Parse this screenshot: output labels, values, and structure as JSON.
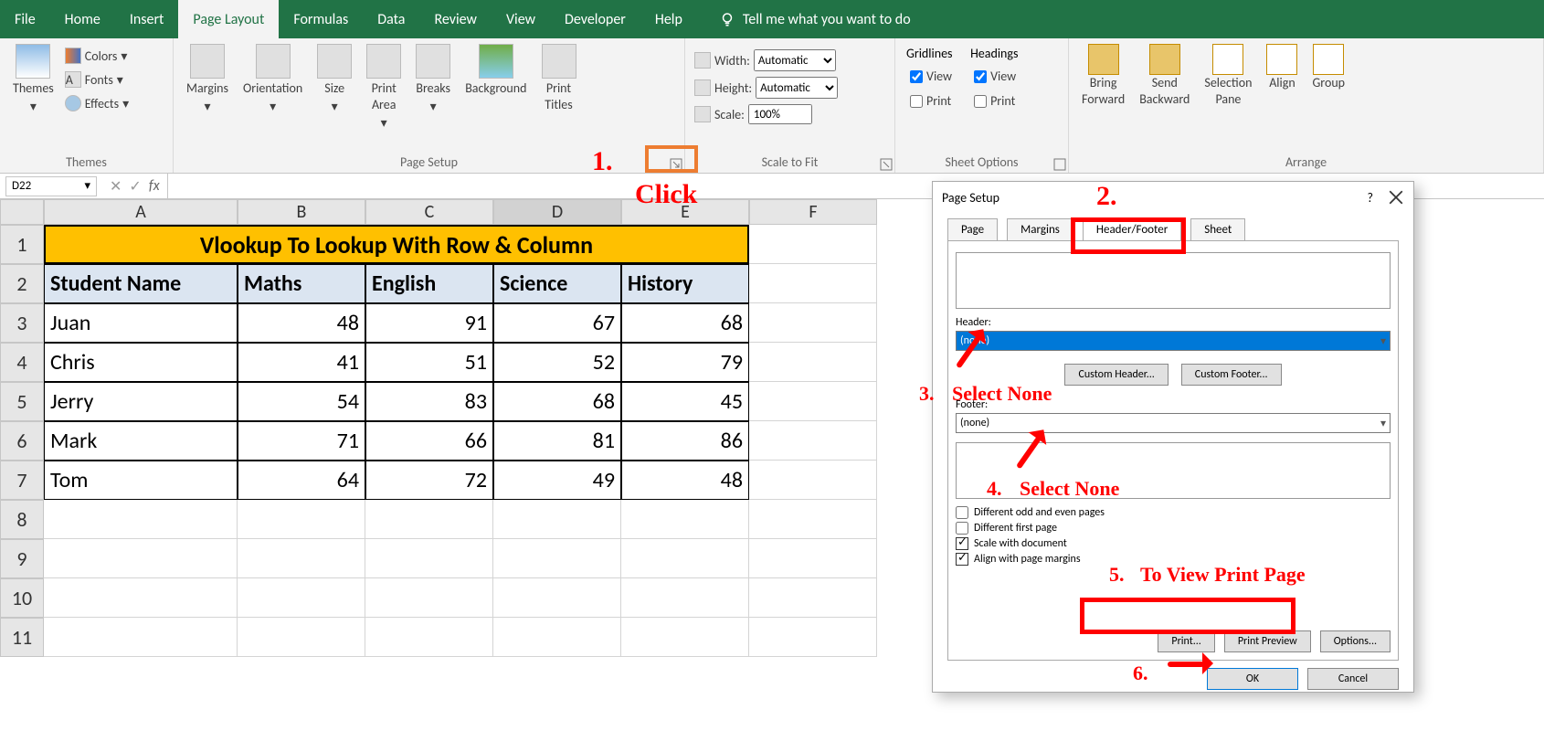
{
  "ribbon": {
    "tabs": [
      "File",
      "Home",
      "Insert",
      "Page Layout",
      "Formulas",
      "Data",
      "Review",
      "View",
      "Developer",
      "Help"
    ],
    "active": "Page Layout",
    "tell_me": "Tell me what you want to do"
  },
  "ribbon_groups": {
    "themes": {
      "label": "Themes",
      "big": "Themes",
      "items": [
        "Colors",
        "Fonts",
        "Effects"
      ]
    },
    "page_setup": {
      "label": "Page Setup",
      "buttons": [
        "Margins",
        "Orientation",
        "Size",
        "Print\nArea",
        "Breaks",
        "Background",
        "Print\nTitles"
      ]
    },
    "scale": {
      "label": "Scale to Fit",
      "width_lbl": "Width:",
      "width_val": "Automatic",
      "height_lbl": "Height:",
      "height_val": "Automatic",
      "scale_lbl": "Scale:",
      "scale_val": "100%"
    },
    "sheet_options": {
      "label": "Sheet Options",
      "gridlines": "Gridlines",
      "headings": "Headings",
      "view": "View",
      "print": "Print"
    },
    "arrange": {
      "label": "Arrange",
      "buttons": [
        "Bring\nForward",
        "Send\nBackward",
        "Selection\nPane",
        "Align",
        "Group"
      ]
    }
  },
  "name_box": "D22",
  "columns": [
    "A",
    "B",
    "C",
    "D",
    "E",
    "F"
  ],
  "rows": [
    "1",
    "2",
    "3",
    "4",
    "5",
    "6",
    "7",
    "8",
    "9",
    "10",
    "11"
  ],
  "title_cell": "Vlookup To Lookup With Row & Column",
  "headers": [
    "Student Name",
    "Maths",
    "English",
    "Science",
    "History"
  ],
  "data": [
    {
      "name": "Juan",
      "m": "48",
      "e": "91",
      "s": "67",
      "h": "68"
    },
    {
      "name": "Chris",
      "m": "41",
      "e": "51",
      "s": "52",
      "h": "79"
    },
    {
      "name": "Jerry",
      "m": "54",
      "e": "83",
      "s": "68",
      "h": "45"
    },
    {
      "name": "Mark",
      "m": "71",
      "e": "66",
      "s": "81",
      "h": "86"
    },
    {
      "name": "Tom",
      "m": "64",
      "e": "72",
      "s": "49",
      "h": "48"
    }
  ],
  "dialog": {
    "title": "Page Setup",
    "help": "?",
    "tabs": [
      "Page",
      "Margins",
      "Header/Footer",
      "Sheet"
    ],
    "active_tab": "Header/Footer",
    "header_label": "Header:",
    "header_value": "(none)",
    "custom_header": "Custom Header...",
    "custom_footer": "Custom Footer...",
    "footer_label": "Footer:",
    "footer_value": "(none)",
    "opts": {
      "odd_even": "Different odd and even pages",
      "first_page": "Different first page",
      "scale_doc": "Scale with document",
      "align_margins": "Align with page margins"
    },
    "print_btn": "Print...",
    "preview_btn": "Print Preview",
    "options_btn": "Options...",
    "ok": "OK",
    "cancel": "Cancel"
  },
  "annotations": {
    "a1_num": "1.",
    "a1_txt": "Click",
    "a2_num": "2.",
    "a3_num": "3.",
    "a3_txt": "Select None",
    "a4_num": "4.",
    "a4_txt": "Select None",
    "a5_num": "5.",
    "a5_txt": "To View Print Page",
    "a6_num": "6."
  }
}
